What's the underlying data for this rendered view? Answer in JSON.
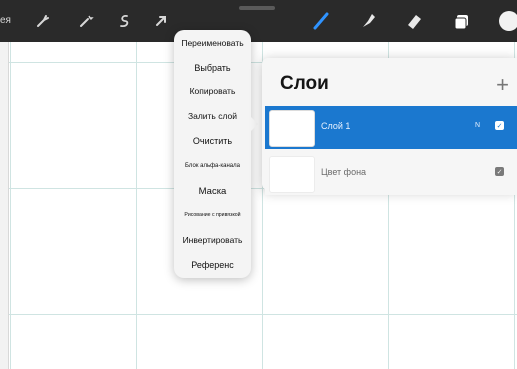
{
  "toolbar": {
    "left_text": "ея",
    "tool_icons": [
      "wrench-icon",
      "magic-wand-icon",
      "selection-icon",
      "transform-arrow-icon"
    ],
    "right_icons": [
      "brush-icon",
      "smudge-icon",
      "eraser-icon",
      "layers-icon",
      "color-icon"
    ],
    "accent": "#2f93ff"
  },
  "context_menu": {
    "items": [
      "Переименовать",
      "Выбрать",
      "Копировать",
      "Залить слой",
      "Очистить",
      "Блок альфа-канала",
      "Маска",
      "Рисование с привязкой",
      "Инвертировать",
      "Референс"
    ]
  },
  "layers_panel": {
    "title": "Слои",
    "add_label": "+",
    "layers": [
      {
        "name": "Слой 1",
        "blend": "N",
        "visible": true,
        "selected": true
      },
      {
        "name": "Цвет фона",
        "visible": true,
        "selected": false
      }
    ],
    "selected_color": "#1b78cf"
  },
  "canvas": {
    "grid_color": "#cfe4e2"
  }
}
